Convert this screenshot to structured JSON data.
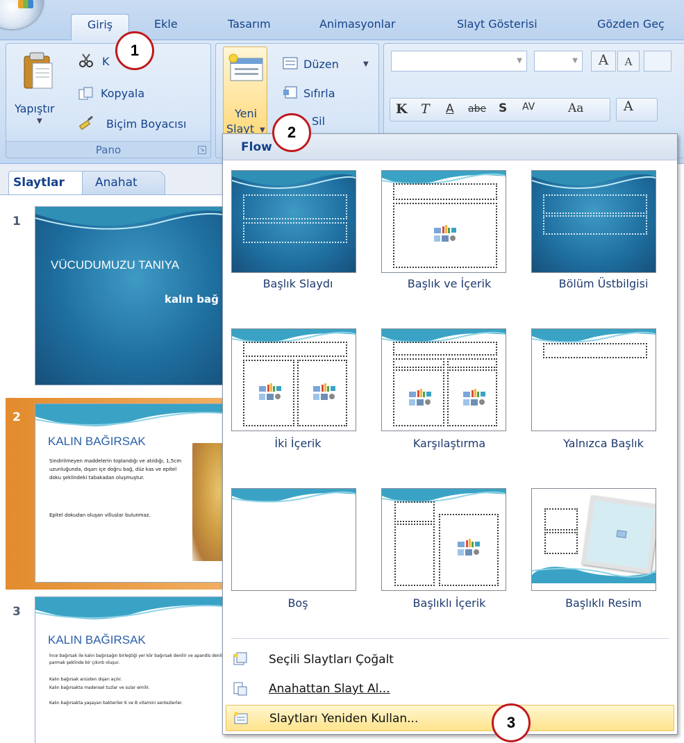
{
  "tabs": [
    "Giriş",
    "Ekle",
    "Tasarım",
    "Animasyonlar",
    "Slayt Gösterisi",
    "Gözden Geç"
  ],
  "pano": {
    "paste_label": "Yapıştır",
    "cut_label": "K",
    "copy_label": "Kopyala",
    "format_painter_label": "Biçim Boyacısı",
    "group_label": "Pano"
  },
  "slides_group": {
    "new_slide_line1": "Yeni",
    "new_slide_line2": "Slayt",
    "layout_label": "Düzen",
    "reset_label": "Sıfırla",
    "delete_label": "Sil"
  },
  "font_group": {
    "bold": "K",
    "italic": "T",
    "underline": "A",
    "strike": "abe",
    "shadow": "S",
    "spacing": "AV",
    "case": "Aa",
    "grow": "A",
    "shrink": "A",
    "color": "A"
  },
  "pane_tabs": {
    "slides": "Slaytlar",
    "outline": "Anahat"
  },
  "slides": [
    {
      "num": "1",
      "title": "VÜCUDUMUZU TANIYA",
      "subtitle": "kalın bağ"
    },
    {
      "num": "2",
      "title": "KALIN BAĞIRSAK",
      "bullet1": "Sindirilmeyen maddelerin toplandığı ve atıldığı, 1,5cm uzunluğunda, dışarı içe doğru bağ, düz kas ve epitel doku şeklindeki tabakadan oluşmuştur.",
      "bullet2": "Epitel dokudan oluşan villuslar bulunmaz."
    },
    {
      "num": "3",
      "title": "KALIN BAĞIRSAK",
      "bullet1": "İnce bağırsak ile kalın bağırsağın birleştiği yer kör bağırsak denilir ve apandis denilen parmak şeklinde bir çıkıntı oluşur.",
      "bullet2": "Kalın bağırsak anüsten dışarı açılır.",
      "bullet3": "Kalın bağırsakta madensel tuzlar ve sular emilir.",
      "bullet4": "Kalın bağırsakta yaşayan bakteriler K ve B vitamini sentezlerler."
    }
  ],
  "dropdown": {
    "header": "Flow",
    "layouts": [
      "Başlık Slaydı",
      "Başlık ve İçerik",
      "Bölüm Üstbilgisi",
      "İki İçerik",
      "Karşılaştırma",
      "Yalnızca Başlık",
      "Boş",
      "Başlıklı İçerik",
      "Başlıklı Resim"
    ],
    "menu": [
      "Seçili Slaytları Çoğalt",
      "Anahattan Slayt Al...",
      "Slaytları Yeniden Kullan..."
    ]
  },
  "markers": [
    "1",
    "2",
    "3"
  ],
  "colors": {
    "ribbon": "#cfe0f5",
    "slide_blue": "#1e6fa0",
    "accent_orange": "#e8943a",
    "marker_red": "#c0191c",
    "menu_highlight": "#ffe38c"
  }
}
